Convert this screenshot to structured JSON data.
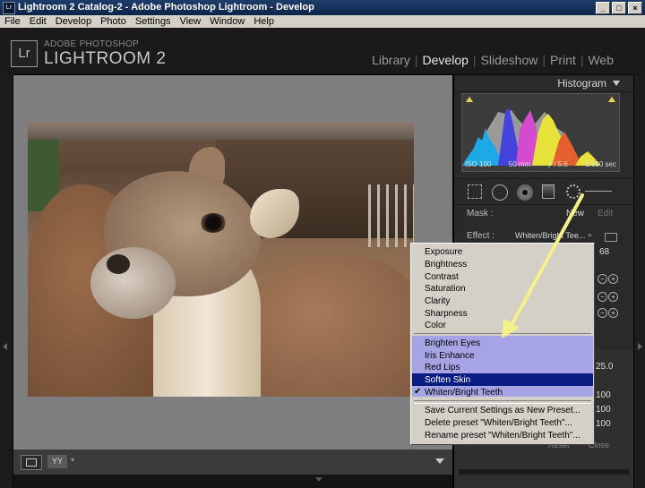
{
  "window": {
    "title": "Lightroom 2 Catalog-2 - Adobe Photoshop Lightroom - Develop",
    "app_icon": "Lr",
    "controls": {
      "minimize": "_",
      "maximize": "□",
      "close": "×"
    }
  },
  "menubar": [
    "File",
    "Edit",
    "Develop",
    "Photo",
    "Settings",
    "View",
    "Window",
    "Help"
  ],
  "header": {
    "logo": "Lr",
    "brand_top": "ADOBE PHOTOSHOP",
    "brand_main": "LIGHTROOM 2",
    "modules": [
      "Library",
      "Develop",
      "Slideshow",
      "Print",
      "Web"
    ],
    "active_module": "Develop",
    "separator": "|"
  },
  "histogram": {
    "title": "Histogram",
    "info": {
      "iso": "ISO 100",
      "focal": "50 mm",
      "aperture": "ƒ / 5.6",
      "shutter": "1/500 sec"
    },
    "clip_color": "#e8d84a"
  },
  "adjustment_brush": {
    "mask_label": "Mask :",
    "new_label": "New",
    "edit_label": "Edit",
    "effect_label": "Effect :",
    "effect_value": "Whiten/Bright Tee... ÷",
    "amount": "68",
    "values": [
      "25.0",
      "100",
      "100",
      "100"
    ],
    "reset_label": "Reset",
    "close_label": "Close"
  },
  "toolbar": {
    "view_mode_label": "YY",
    "view_mode_caret": "▾"
  },
  "effect_menu": {
    "items": [
      "Exposure",
      "Brightness",
      "Contrast",
      "Saturation",
      "Clarity",
      "Sharpness",
      "Color"
    ],
    "presets": [
      "Brighten Eyes",
      "Iris Enhance",
      "Red Lips",
      "Soften Skin",
      "Whiten/Bright Teeth"
    ],
    "checked_preset": "Whiten/Bright Teeth",
    "checkmark": "✔",
    "hover_item": "Soften Skin",
    "actions": [
      "Save Current Settings as New Preset...",
      "Delete preset \"Whiten/Bright Teeth\"...",
      "Rename preset \"Whiten/Bright Teeth\"..."
    ],
    "highlight_color": "#a7a4e6",
    "selection_color": "#0a1c80"
  },
  "annotation": {
    "arrow_color": "#f4f08a"
  }
}
